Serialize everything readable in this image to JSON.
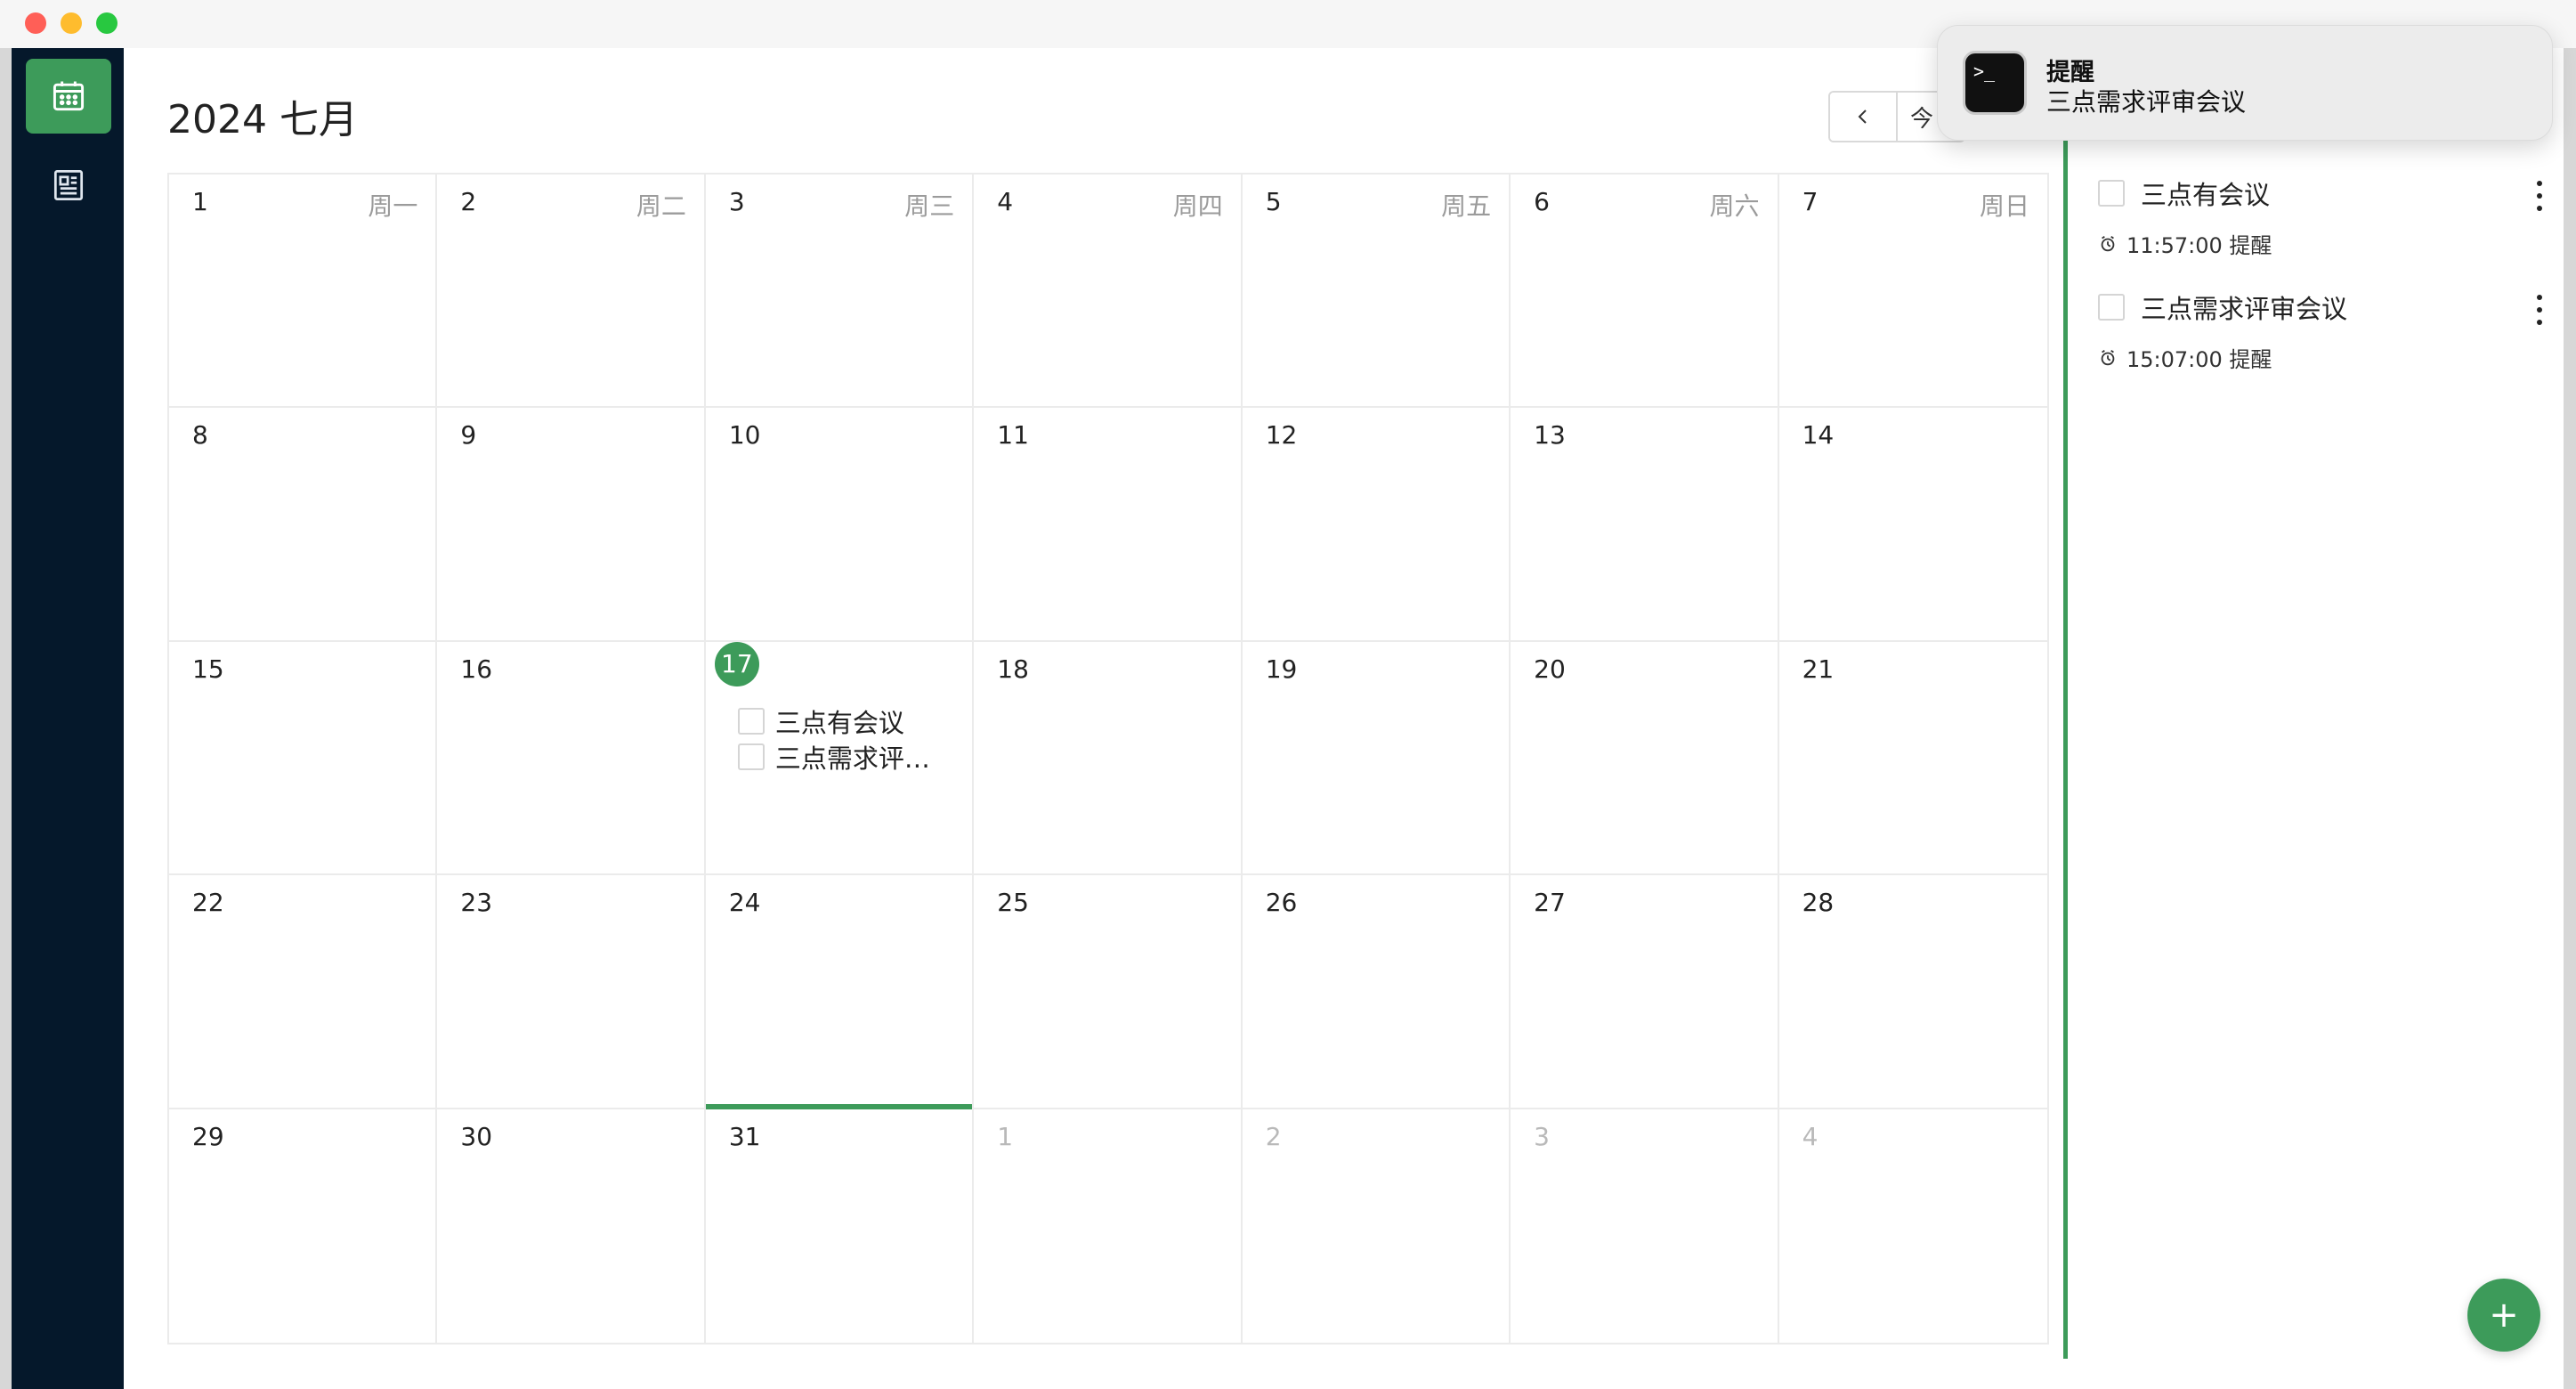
{
  "window": {
    "title": ""
  },
  "sidebar": {
    "items": [
      {
        "icon": "calendar-icon",
        "active": true
      },
      {
        "icon": "document-icon",
        "active": false
      }
    ]
  },
  "header": {
    "month_title": "2024 七月",
    "prev_icon": "chevron-left-icon",
    "today_label_visible": "今"
  },
  "calendar": {
    "weekdays": [
      "周一",
      "周二",
      "周三",
      "周四",
      "周五",
      "周六",
      "周日"
    ],
    "weeks": [
      [
        {
          "day": "1"
        },
        {
          "day": "2"
        },
        {
          "day": "3"
        },
        {
          "day": "4"
        },
        {
          "day": "5"
        },
        {
          "day": "6"
        },
        {
          "day": "7"
        }
      ],
      [
        {
          "day": "8"
        },
        {
          "day": "9"
        },
        {
          "day": "10"
        },
        {
          "day": "11"
        },
        {
          "day": "12"
        },
        {
          "day": "13"
        },
        {
          "day": "14"
        }
      ],
      [
        {
          "day": "15"
        },
        {
          "day": "16"
        },
        {
          "day": "17",
          "today": true,
          "events": [
            "三点有会议",
            "三点需求评…"
          ]
        },
        {
          "day": "18"
        },
        {
          "day": "19"
        },
        {
          "day": "20"
        },
        {
          "day": "21"
        }
      ],
      [
        {
          "day": "22"
        },
        {
          "day": "23"
        },
        {
          "day": "24",
          "selected": true
        },
        {
          "day": "25"
        },
        {
          "day": "26"
        },
        {
          "day": "27"
        },
        {
          "day": "28"
        }
      ],
      [
        {
          "day": "29"
        },
        {
          "day": "30"
        },
        {
          "day": "31"
        },
        {
          "day": "1",
          "other": true
        },
        {
          "day": "2",
          "other": true
        },
        {
          "day": "3",
          "other": true
        },
        {
          "day": "4",
          "other": true
        }
      ]
    ]
  },
  "todo_panel": {
    "items": [
      {
        "title": "三点有会议",
        "reminder": "11:57:00 提醒"
      },
      {
        "title": "三点需求评审会议",
        "reminder": "15:07:00 提醒"
      }
    ]
  },
  "notification": {
    "app_icon": "terminal-icon",
    "title": "提醒",
    "body": "三点需求评审会议"
  },
  "fab": {
    "label": "+"
  },
  "colors": {
    "accent": "#3d9b5a",
    "sidebar": "#05182b"
  }
}
